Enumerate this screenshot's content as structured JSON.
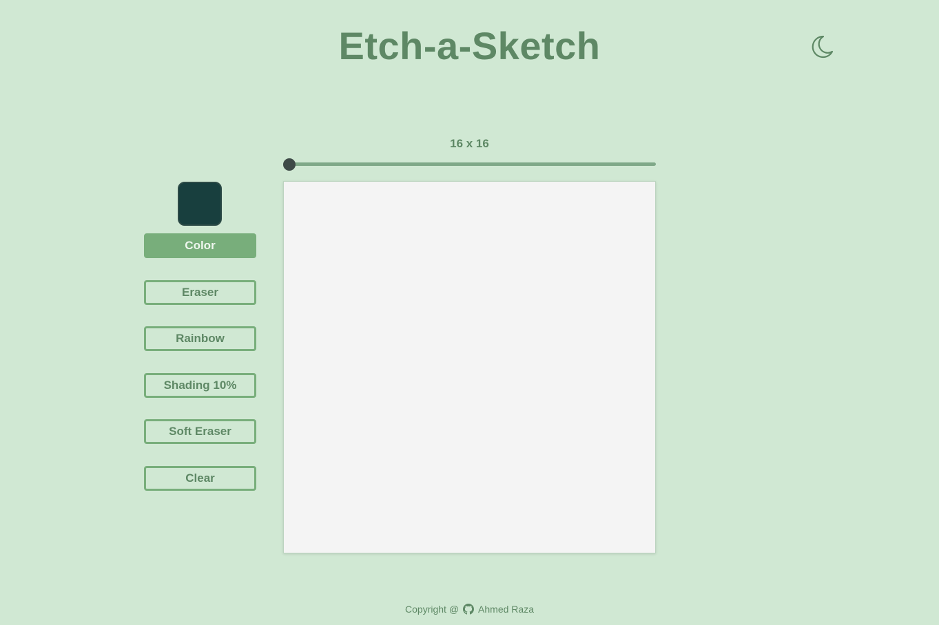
{
  "header": {
    "title": "Etch-a-Sketch",
    "theme_icon": "moon-icon"
  },
  "grid": {
    "size_label": "16 x 16",
    "slider_value": 16,
    "slider_min": 16,
    "canvas_color": "#f4f4f4"
  },
  "tools": {
    "current_color": "#183f3e",
    "color_label": "Color",
    "eraser_label": "Eraser",
    "rainbow_label": "Rainbow",
    "shading_label": "Shading 10%",
    "soft_eraser_label": "Soft Eraser",
    "clear_label": "Clear",
    "active": "Color"
  },
  "footer": {
    "copyright": "Copyright @",
    "icon": "github-icon",
    "author": "Ahmed Raza"
  },
  "colors": {
    "background": "#d0e8d3",
    "accent": "#78ae7b",
    "text": "#5e8865"
  }
}
